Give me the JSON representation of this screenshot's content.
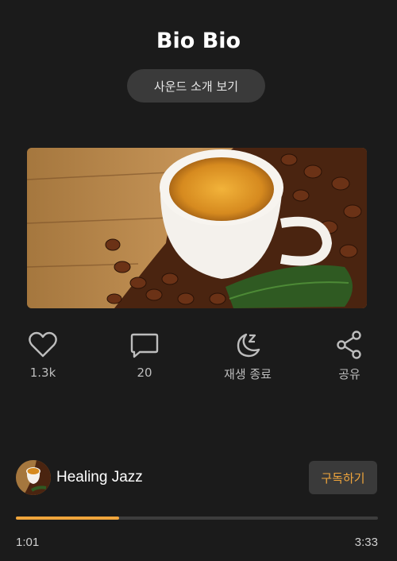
{
  "header": {
    "title": "Bio Bio",
    "intro_button": "사운드 소개 보기"
  },
  "actions": [
    {
      "icon": "heart-icon",
      "label": "1.3k"
    },
    {
      "icon": "comment-icon",
      "label": "20"
    },
    {
      "icon": "sleep-timer-icon",
      "label": "재생 종료"
    },
    {
      "icon": "share-icon",
      "label": "공유"
    }
  ],
  "channel": {
    "name": "Healing Jazz",
    "subscribe_label": "구독하기"
  },
  "player": {
    "current_time": "1:01",
    "total_time": "3:33",
    "progress": 0.286
  },
  "colors": {
    "accent": "#f0a53c",
    "background": "#1b1b1b",
    "button_bg": "#3a3a3a"
  }
}
